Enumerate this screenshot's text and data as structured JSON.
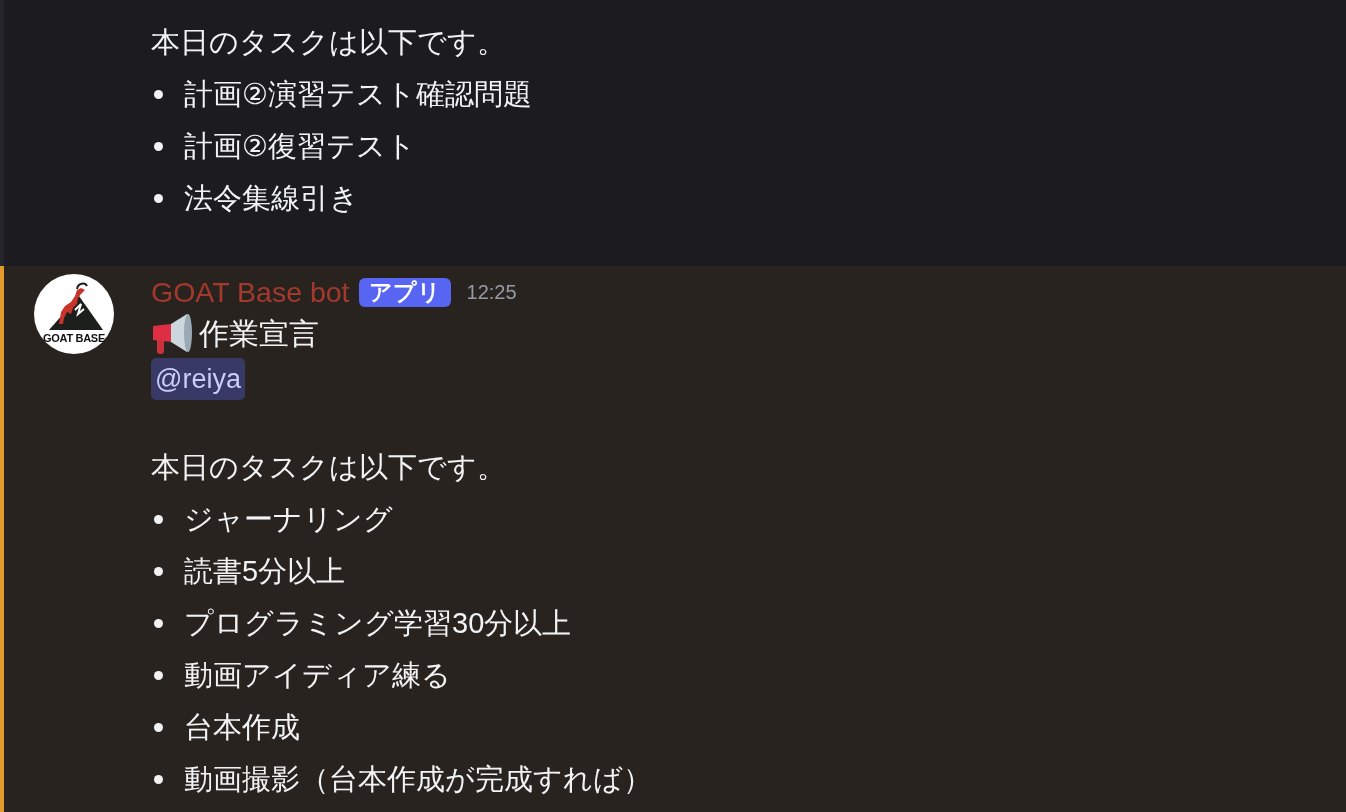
{
  "messages": [
    {
      "highlighted": false,
      "body": [
        {
          "kind": "text",
          "text": "本日のタスクは以下です。"
        },
        {
          "kind": "bullet",
          "text": "計画②演習テスト確認問題"
        },
        {
          "kind": "bullet",
          "text": "計画②復習テスト"
        },
        {
          "kind": "bullet",
          "text": "法令集線引き"
        }
      ]
    },
    {
      "highlighted": true,
      "author": {
        "name": "GOAT Base bot",
        "badge": "アプリ",
        "avatar_text": "GOAT BASE"
      },
      "time": "12:25",
      "body": [
        {
          "kind": "announcement",
          "text": "作業宣言"
        },
        {
          "kind": "mention",
          "text": "@reiya"
        },
        {
          "kind": "spacer"
        },
        {
          "kind": "text",
          "text": "本日のタスクは以下です。"
        },
        {
          "kind": "bullet",
          "text": "ジャーナリング"
        },
        {
          "kind": "bullet",
          "text": "読書5分以上"
        },
        {
          "kind": "bullet",
          "text": "プログラミング学習30分以上"
        },
        {
          "kind": "bullet",
          "text": "動画アイディア練る"
        },
        {
          "kind": "bullet",
          "text": "台本作成"
        },
        {
          "kind": "bullet",
          "text": "動画撮影（台本作成が完成すれば）"
        }
      ]
    }
  ]
}
